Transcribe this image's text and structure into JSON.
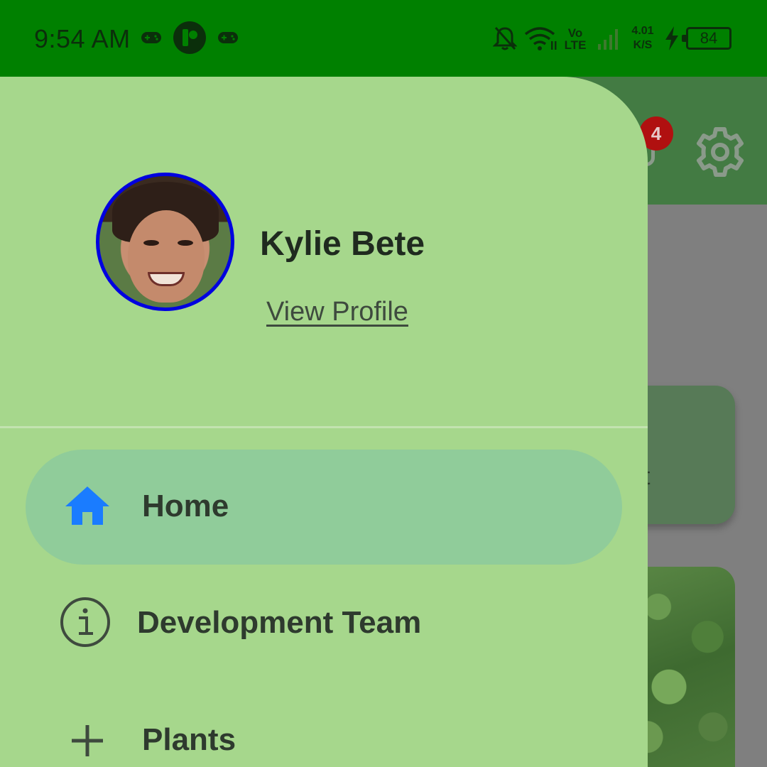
{
  "status_bar": {
    "time": "9:54 AM",
    "network_type_top": "Vo",
    "network_type_bottom": "LTE",
    "speed_value": "4.01",
    "speed_unit": "K/S",
    "battery": "84",
    "icons": [
      "gamepad-icon",
      "app-icon",
      "gamepad-icon",
      "bell-off-icon",
      "wifi-icon",
      "signal-icon",
      "charging-icon",
      "battery-icon"
    ]
  },
  "app_header": {
    "notification_count": "4",
    "icons": [
      "bell-icon",
      "settings-icon"
    ]
  },
  "background_card": {
    "visible_text": "t"
  },
  "drawer": {
    "user_name": "Kylie Bete",
    "view_profile_link": "View Profile",
    "items": [
      {
        "label": "Home",
        "icon": "home-icon",
        "active": true
      },
      {
        "label": "Development Team",
        "icon": "info-icon",
        "active": false
      },
      {
        "label": "Plants",
        "icon": "plus-icon",
        "active": false
      }
    ]
  },
  "colors": {
    "status_bar": "#008000",
    "drawer_bg": "#a6d78c",
    "active_item_bg": "#90cc9a",
    "home_icon": "#1a7cff",
    "avatar_ring": "#0000e0",
    "badge": "#b01010"
  }
}
